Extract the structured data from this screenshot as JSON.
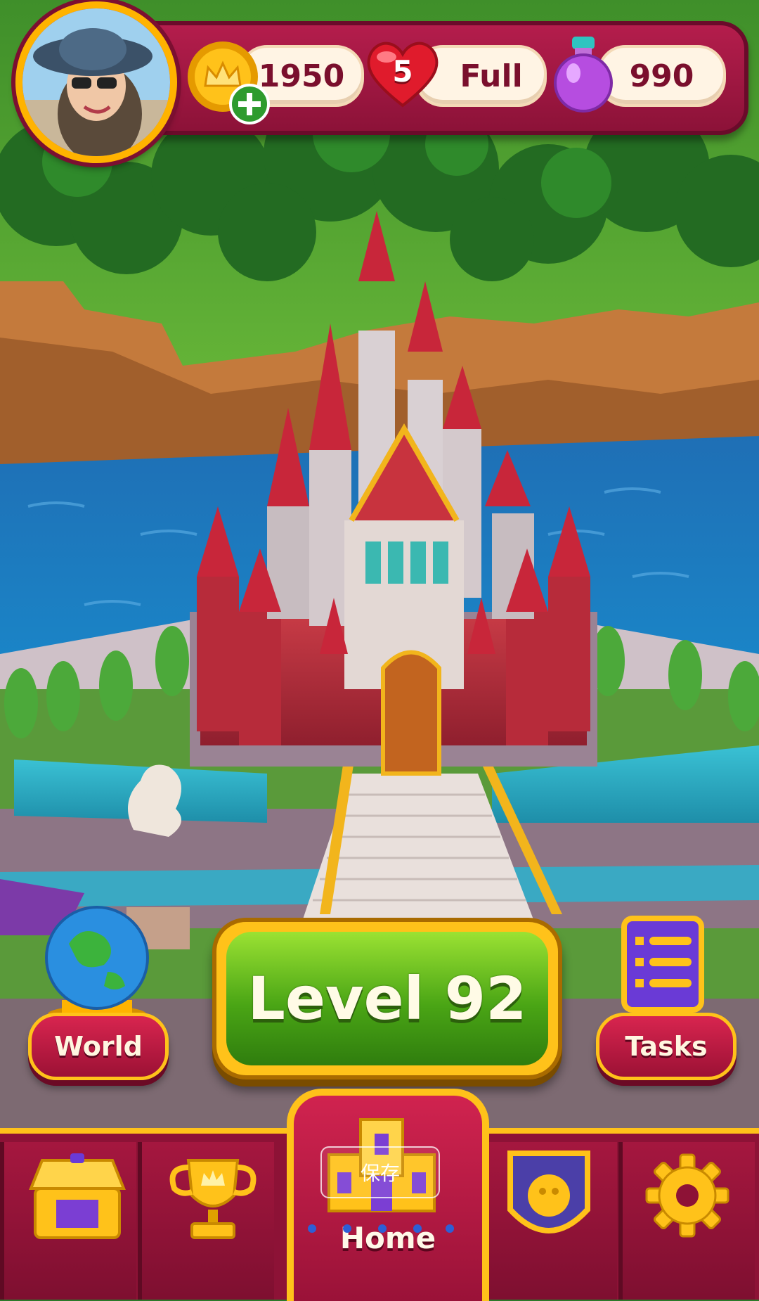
{
  "hud": {
    "coins": "1950",
    "lives": "5",
    "lives_status": "Full",
    "potions": "990"
  },
  "buttons": {
    "level": "Level 92",
    "world": "World",
    "tasks": "Tasks"
  },
  "nav": {
    "home_label": "Home"
  },
  "overlay": {
    "save_label": "保存"
  },
  "colors": {
    "accent_gold": "#ffc21a",
    "brand_red": "#b41d4c",
    "play_green": "#4aa515"
  },
  "icons": [
    "coin-crown-icon",
    "add-coins-icon",
    "heart-icon",
    "potion-icon",
    "globe-icon",
    "scroll-icon",
    "shop-icon",
    "trophy-icon",
    "castle-icon",
    "team-shield-icon",
    "gear-icon"
  ]
}
